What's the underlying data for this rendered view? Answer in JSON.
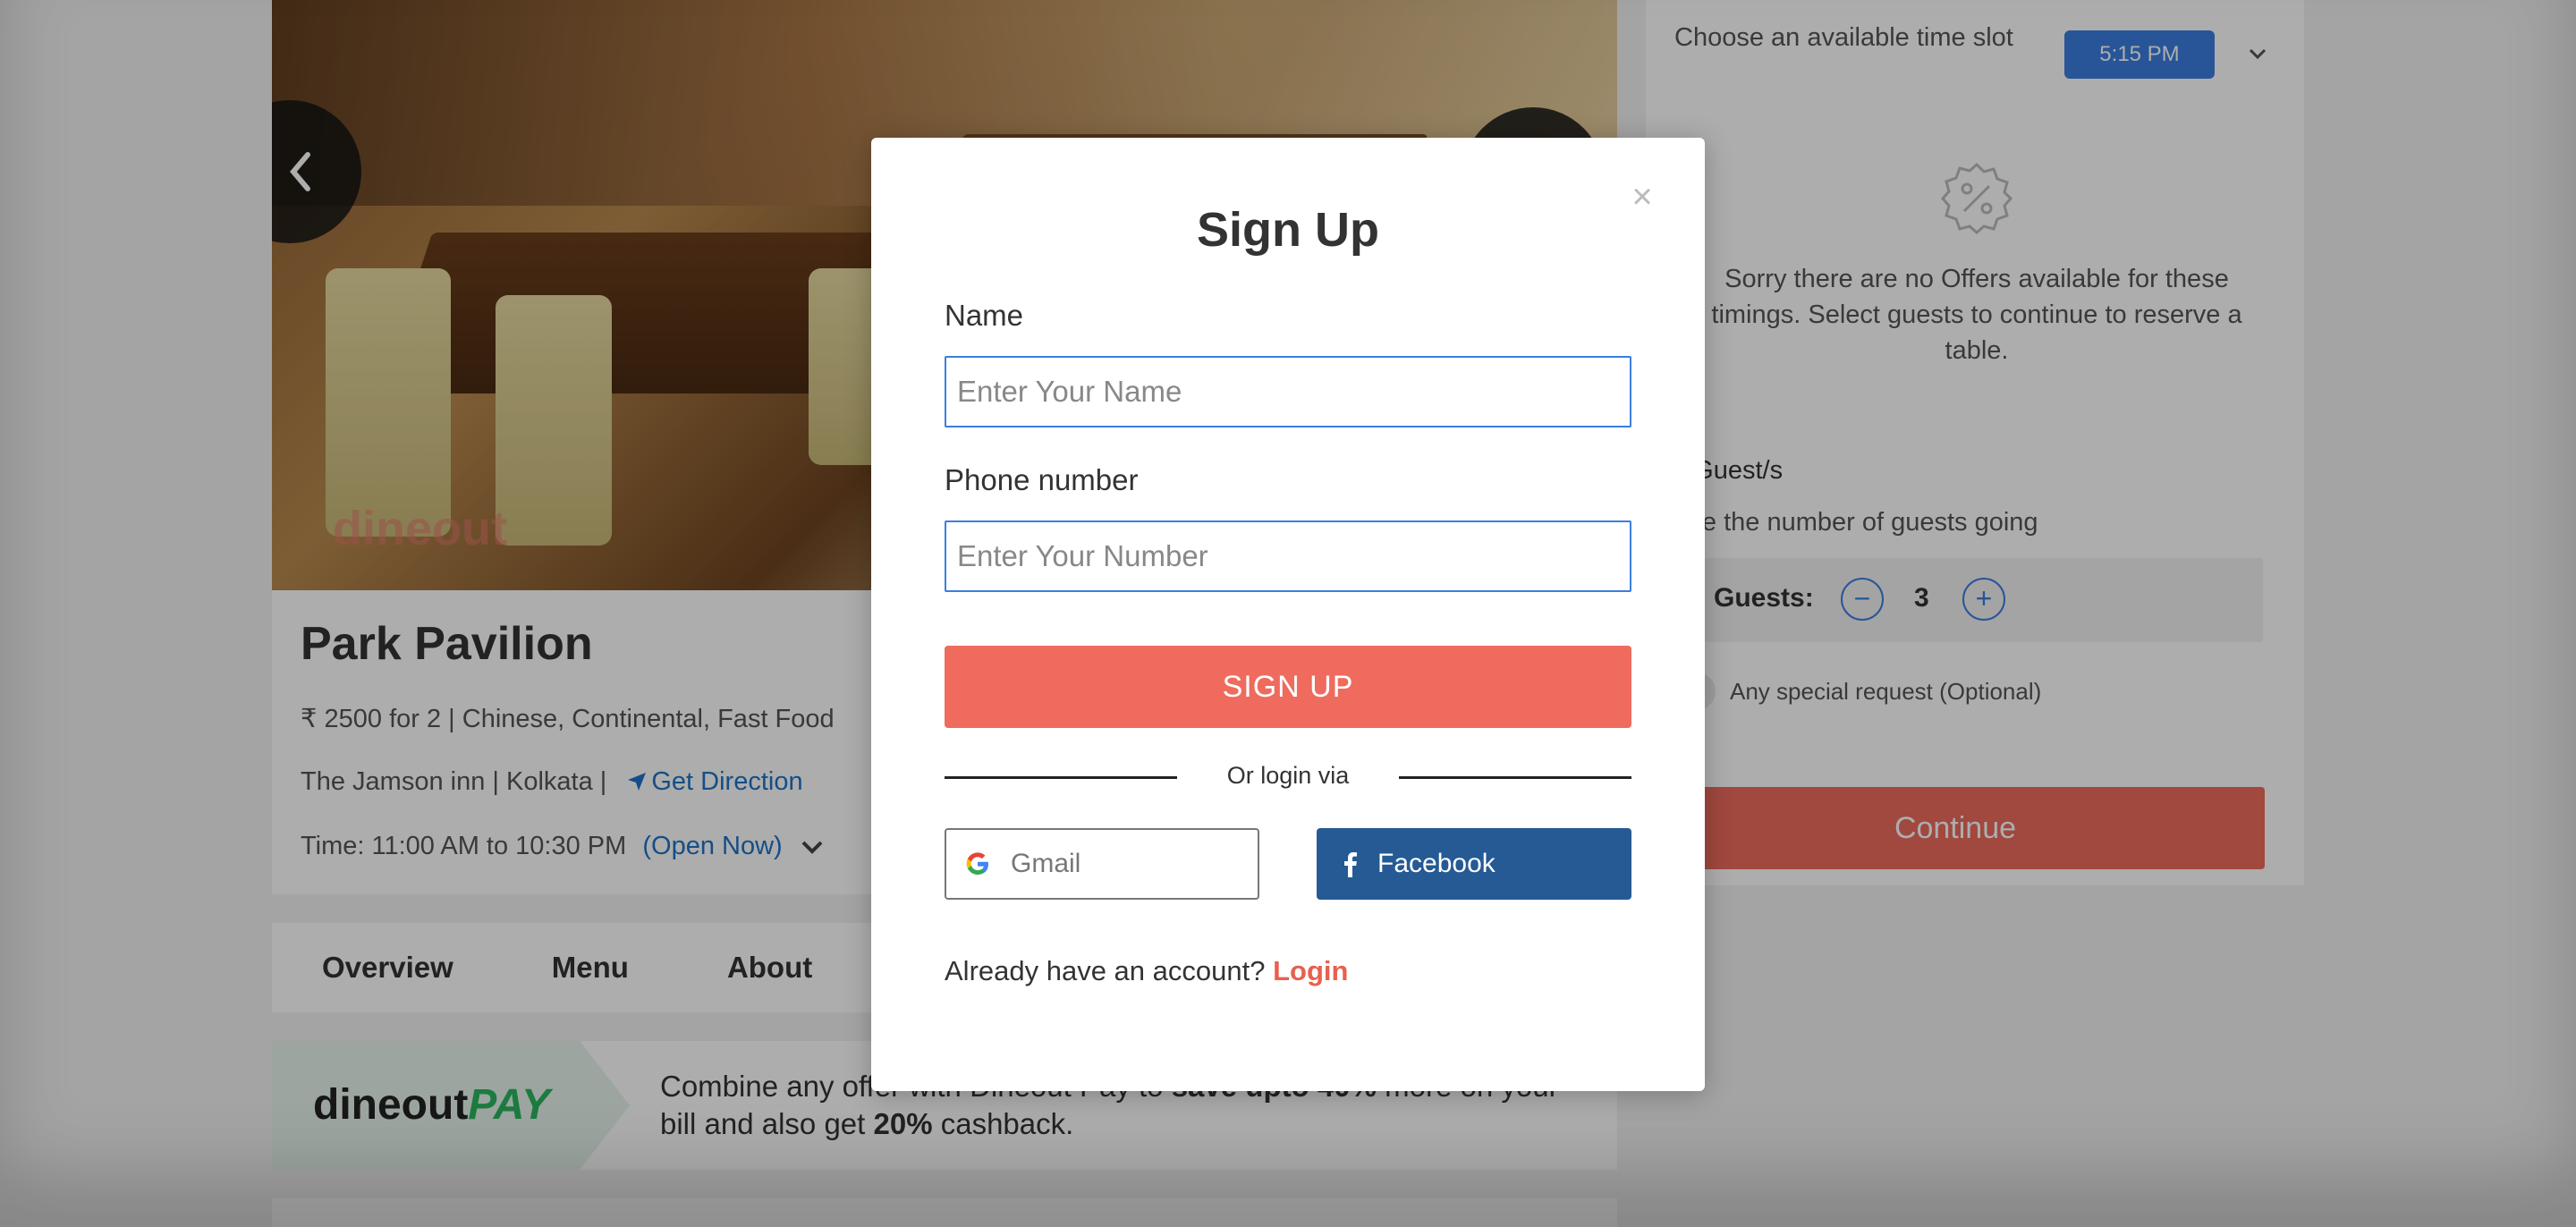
{
  "restaurant": {
    "name": "Park Pavilion",
    "price_cuisine": "₹ 2500 for 2 | Chinese, Continental, Fast Food",
    "location": "The Jamson inn | Kolkata |",
    "direction_link": "Get Direction",
    "time": "Time: 11:00 AM to 10:30 PM",
    "open_status": "(Open Now)",
    "watermark": "dineout"
  },
  "tabs": [
    "Overview",
    "Menu",
    "About"
  ],
  "pay_banner": {
    "logo_text": "dineout",
    "logo_pay": "PAY",
    "text_part1": "Combine any offer with Dineout Pay to ",
    "text_bold1": "save upto 40%",
    "text_part2": " more on your bill and also get ",
    "text_bold2": "20%",
    "text_part3": " cashback."
  },
  "booking": {
    "slot_label": "Choose an available time slot",
    "slot_value": "5:15 PM",
    "offer_message": "Sorry there are no Offers available for these timings. Select guests to continue to reserve a table.",
    "guests_heading": "lect Guest/s",
    "guests_sub": "hoose the number of guests going",
    "guests_label": "Guests:",
    "guests_count": "3",
    "special_request": "Any special request (Optional)",
    "continue_label": "Continue"
  },
  "modal": {
    "title": "Sign Up",
    "close_symbol": "×",
    "name_label": "Name",
    "name_placeholder": "Enter Your Name",
    "phone_label": "Phone number",
    "phone_placeholder": "Enter Your Number",
    "signup_label": "SIGN UP",
    "divider_text": "Or login via",
    "gmail_label": "Gmail",
    "facebook_label": "Facebook",
    "account_text": "Already have an account? ",
    "login_link": "Login"
  },
  "colors": {
    "accent_blue": "#3a7ee0",
    "signup_red": "#ef6b5e",
    "facebook_blue": "#255a94",
    "login_red": "#e8604f",
    "pay_green": "#2bb55f"
  }
}
